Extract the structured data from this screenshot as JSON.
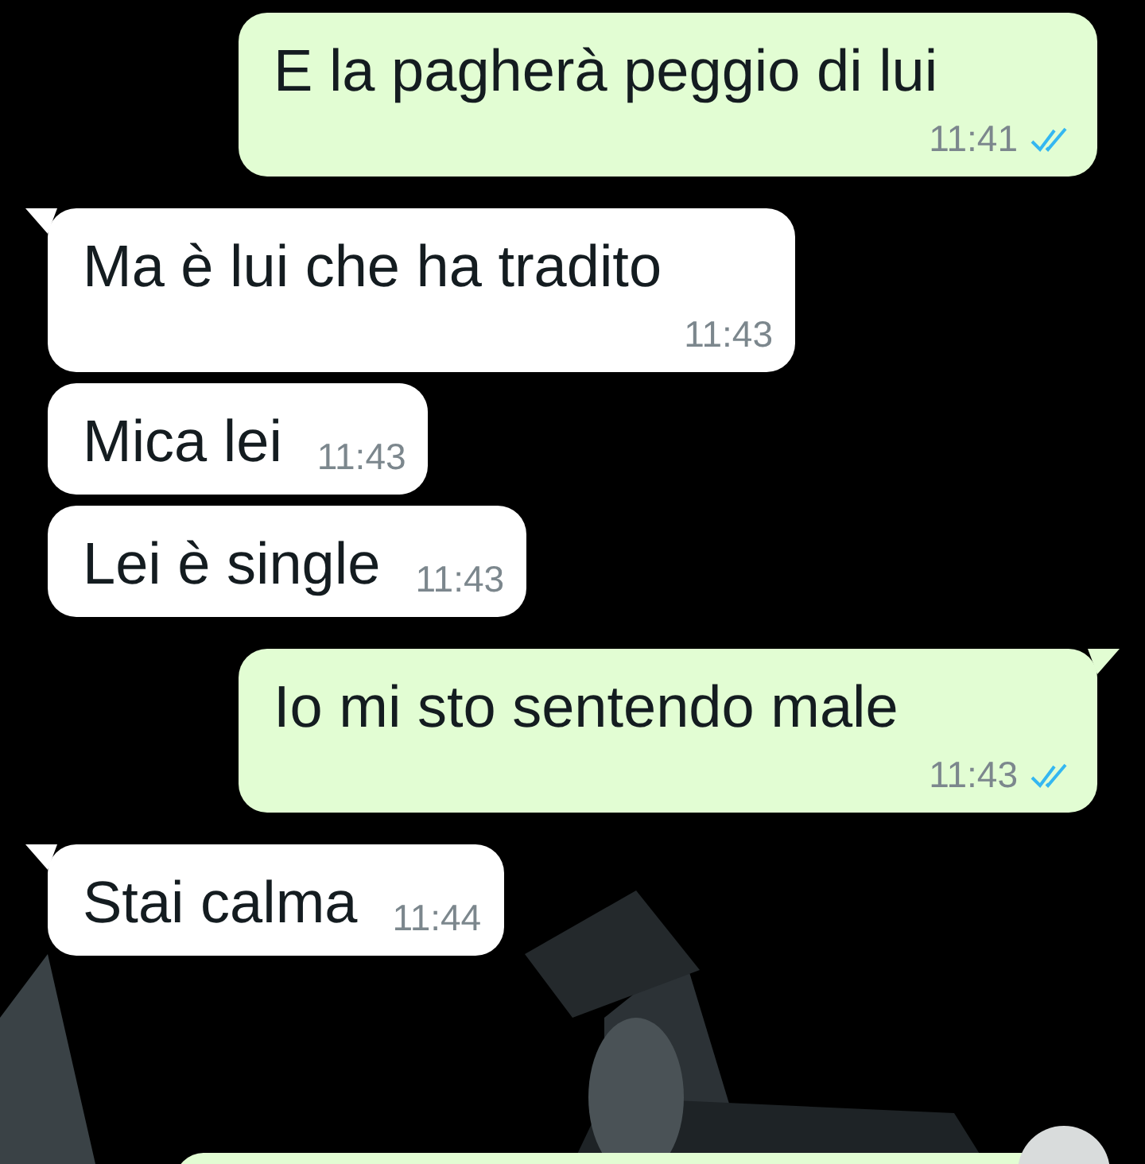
{
  "messages": [
    {
      "kind": "outgoing",
      "text": "E la pagherà peggio di lui",
      "time": "11:41",
      "tail": false,
      "read": true
    },
    {
      "kind": "incoming",
      "text": "Ma è lui che ha tradito",
      "time": "11:43",
      "tail": true
    },
    {
      "kind": "incoming",
      "text": "Mica lei",
      "time": "11:43",
      "tail": false
    },
    {
      "kind": "incoming",
      "text": "Lei è single",
      "time": "11:43",
      "tail": false
    },
    {
      "kind": "outgoing",
      "text": "Io mi sto sentendo male",
      "time": "11:43",
      "tail": true,
      "read": true
    },
    {
      "kind": "incoming",
      "text": "Stai calma",
      "time": "11:44",
      "tail": true
    }
  ]
}
